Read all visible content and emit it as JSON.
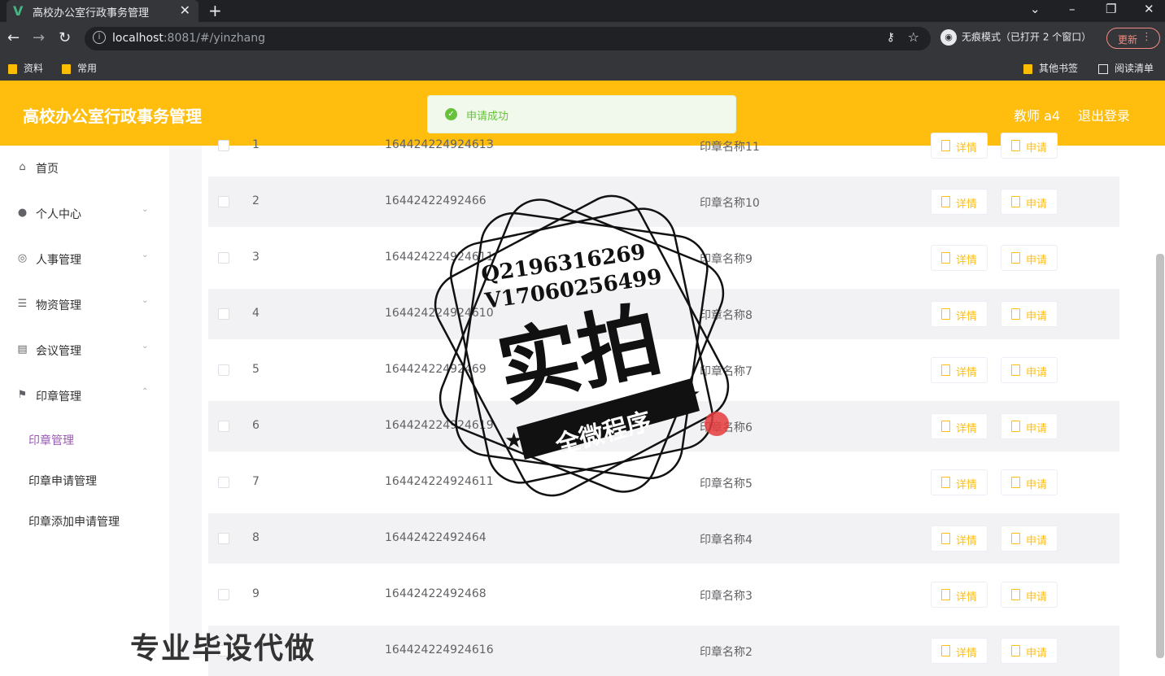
{
  "browser": {
    "tab_title": "高校办公室行政事务管理",
    "url_host": "localhost",
    "url_rest": ":8081/#/yinzhang",
    "incognito_label": "无痕模式（已打开 2 个窗口）",
    "update_label": "更新",
    "bookmarks": [
      "资料",
      "常用"
    ],
    "bookmarks_right": [
      "其他书签",
      "阅读清单"
    ]
  },
  "header": {
    "title": "高校办公室行政事务管理",
    "user": "教师 a4",
    "logout": "退出登录",
    "accent": "#ffbe0d"
  },
  "toast": {
    "message": "申请成功",
    "color": "#67c23a"
  },
  "sidebar": {
    "items": [
      {
        "label": "首页",
        "icon": "home-icon"
      },
      {
        "label": "个人中心",
        "icon": "user-icon"
      },
      {
        "label": "人事管理",
        "icon": "personnel-icon"
      },
      {
        "label": "物资管理",
        "icon": "list-icon"
      },
      {
        "label": "会议管理",
        "icon": "printer-icon"
      },
      {
        "label": "印章管理",
        "icon": "flag-icon"
      }
    ],
    "subitems": [
      "印章管理",
      "印章申请管理",
      "印章添加申请管理"
    ]
  },
  "table": {
    "detail_label": "详情",
    "apply_label": "申请",
    "rows": [
      {
        "index": "1",
        "number": "16442422492461З",
        "name": "印章名称11"
      },
      {
        "index": "2",
        "number": "16442422492466",
        "name": "印章名称10"
      },
      {
        "index": "3",
        "number": "164424224924611",
        "name": "印章名称9"
      },
      {
        "index": "4",
        "number": "164424224924610",
        "name": "印章名称8"
      },
      {
        "index": "5",
        "number": "16442422492469",
        "name": "印章名称7"
      },
      {
        "index": "6",
        "number": "164424224924619",
        "name": "印章名称6"
      },
      {
        "index": "7",
        "number": "164424224924611",
        "name": "印章名称5"
      },
      {
        "index": "8",
        "number": "16442422492464",
        "name": "印章名称4"
      },
      {
        "index": "9",
        "number": "16442422492468",
        "name": "印章名称3"
      },
      {
        "index": "",
        "number": "164424224924616",
        "name": "印章名称2"
      }
    ]
  },
  "watermark": {
    "contact_q": "Q2196316269",
    "contact_v": "V1706025649​9",
    "big": "实拍",
    "ribbon": "全微程序",
    "bottom_text": "专业毕设代做"
  }
}
